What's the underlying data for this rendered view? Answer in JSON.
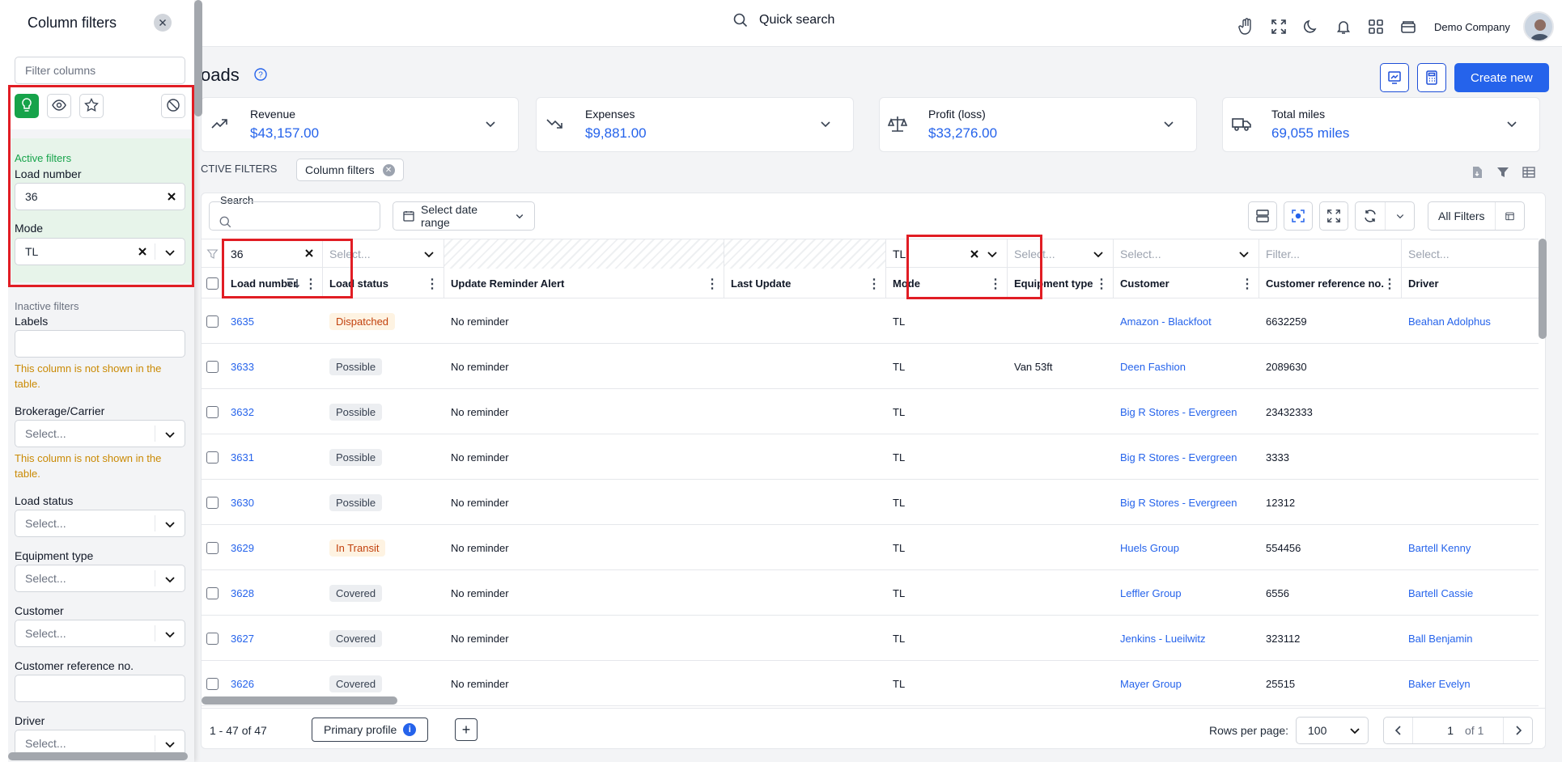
{
  "topbar": {
    "quick_search": "Quick search",
    "company": "Demo Company"
  },
  "page": {
    "title": "oads"
  },
  "header": {
    "create_label": "Create new"
  },
  "cards": [
    {
      "label": "Revenue",
      "value": "$43,157.00"
    },
    {
      "label": "Expenses",
      "value": "$9,881.00"
    },
    {
      "label": "Profit (loss)",
      "value": "$33,276.00"
    },
    {
      "label": "Total miles",
      "value": "69,055 miles"
    }
  ],
  "active_filters": {
    "label": "CTIVE FILTERS",
    "chip": "Column filters"
  },
  "toolbar": {
    "search_label": "Search",
    "date_range": "Select date range",
    "all_filters": "All Filters"
  },
  "filter_row": {
    "load_number": "36",
    "load_status": "Select...",
    "mode": "TL",
    "equipment_type": "Select...",
    "customer": "Select...",
    "customer_ref": "Filter...",
    "driver": "Select..."
  },
  "columns": [
    "Load number",
    "Load status",
    "Update Reminder Alert",
    "Last Update",
    "Mode",
    "Equipment type",
    "Customer",
    "Customer reference no.",
    "Driver"
  ],
  "rows": [
    {
      "load": "3635",
      "status": "Dispatched",
      "status_style": "orange",
      "reminder": "No reminder",
      "mode": "TL",
      "equip": "",
      "customer": "Amazon - Blackfoot",
      "ref": "6632259",
      "driver": "Beahan Adolphus"
    },
    {
      "load": "3633",
      "status": "Possible",
      "status_style": "gray",
      "reminder": "No reminder",
      "mode": "TL",
      "equip": "Van 53ft",
      "customer": "Deen Fashion",
      "ref": "2089630",
      "driver": ""
    },
    {
      "load": "3632",
      "status": "Possible",
      "status_style": "gray",
      "reminder": "No reminder",
      "mode": "TL",
      "equip": "",
      "customer": "Big R Stores - Evergreen",
      "ref": "23432333",
      "driver": ""
    },
    {
      "load": "3631",
      "status": "Possible",
      "status_style": "gray",
      "reminder": "No reminder",
      "mode": "TL",
      "equip": "",
      "customer": "Big R Stores - Evergreen",
      "ref": "3333",
      "driver": ""
    },
    {
      "load": "3630",
      "status": "Possible",
      "status_style": "gray",
      "reminder": "No reminder",
      "mode": "TL",
      "equip": "",
      "customer": "Big R Stores - Evergreen",
      "ref": "12312",
      "driver": ""
    },
    {
      "load": "3629",
      "status": "In Transit",
      "status_style": "orange",
      "reminder": "No reminder",
      "mode": "TL",
      "equip": "",
      "customer": "Huels Group",
      "ref": "554456",
      "driver": "Bartell Kenny"
    },
    {
      "load": "3628",
      "status": "Covered",
      "status_style": "gray",
      "reminder": "No reminder",
      "mode": "TL",
      "equip": "",
      "customer": "Leffler Group",
      "ref": "6556",
      "driver": "Bartell Cassie"
    },
    {
      "load": "3627",
      "status": "Covered",
      "status_style": "gray",
      "reminder": "No reminder",
      "mode": "TL",
      "equip": "",
      "customer": "Jenkins - Lueilwitz",
      "ref": "323112",
      "driver": "Ball Benjamin"
    },
    {
      "load": "3626",
      "status": "Covered",
      "status_style": "gray",
      "reminder": "No reminder",
      "mode": "TL",
      "equip": "",
      "customer": "Mayer Group",
      "ref": "25515",
      "driver": "Baker Evelyn"
    }
  ],
  "footer": {
    "count": "1 - 47 of 47",
    "profile": "Primary profile",
    "rows_per_page_label": "Rows per page:",
    "rows_per_page": "100",
    "page": "1",
    "of": "of 1"
  },
  "sidebar": {
    "title": "Column filters",
    "filter_placeholder": "Filter columns",
    "active_label": "Active filters",
    "load_number_label": "Load number",
    "load_number_value": "36",
    "mode_label": "Mode",
    "mode_value": "TL",
    "inactive_label": "Inactive filters",
    "labels_label": "Labels",
    "not_shown": "This column is not shown in the table.",
    "brokerage_label": "Brokerage/Carrier",
    "load_status_label": "Load status",
    "equipment_label": "Equipment type",
    "customer_label": "Customer",
    "customer_ref_label": "Customer reference no.",
    "driver_label": "Driver",
    "select_placeholder": "Select..."
  },
  "colors": {
    "accent": "#2563eb",
    "active": "#16a34a",
    "warn": "#ca8a04",
    "highlight": "#e11d24"
  }
}
